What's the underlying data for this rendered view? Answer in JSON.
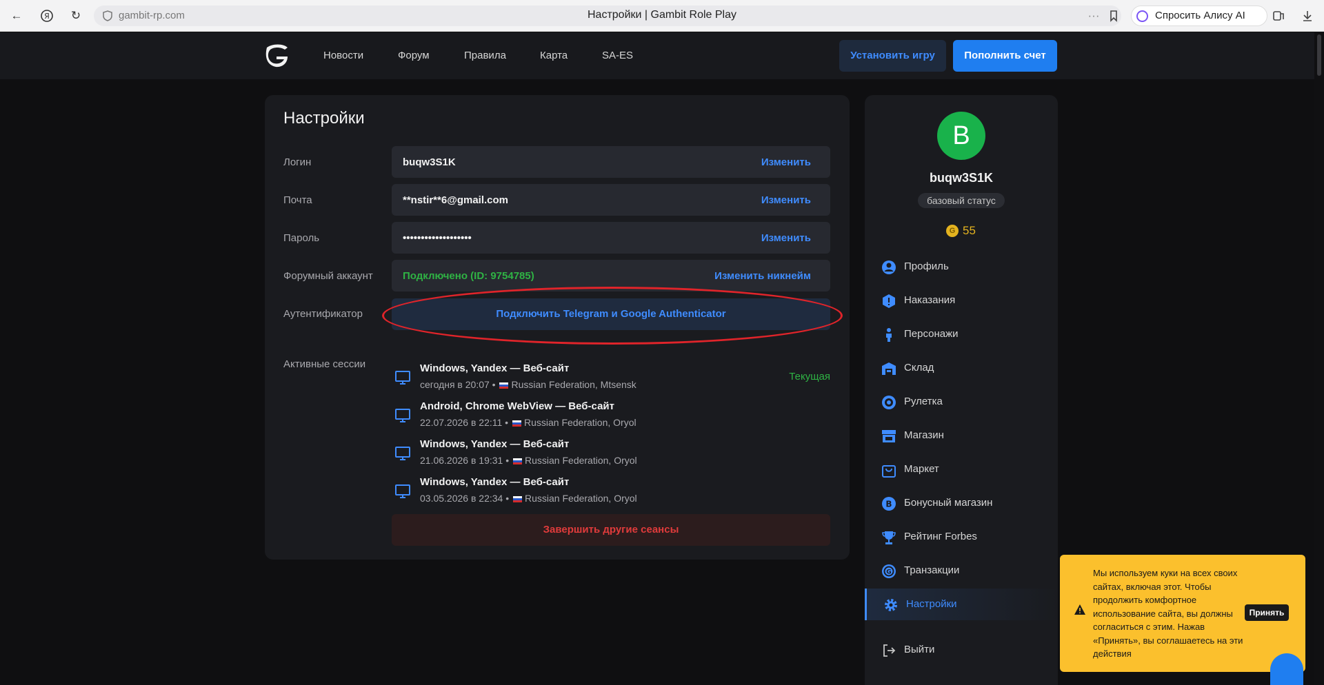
{
  "browser": {
    "url": "gambit-rp.com",
    "tab_title": "Настройки | Gambit Role Play",
    "alice_label": "Спросить Алису AI"
  },
  "nav": {
    "items": [
      "Новости",
      "Форум",
      "Правила",
      "Карта",
      "SA-ES"
    ],
    "install_label": "Установить игру",
    "topup_label": "Пополнить счет"
  },
  "settings": {
    "title": "Настройки",
    "rows": [
      {
        "label": "Логин",
        "value": "buqw3S1K",
        "action": "Изменить"
      },
      {
        "label": "Почта",
        "value": "**nstir**6@gmail.com",
        "action": "Изменить"
      },
      {
        "label": "Пароль",
        "value": "•••••••••••••••••••",
        "action": "Изменить"
      },
      {
        "label": "Форумный аккаунт",
        "value": "Подключено (ID: 9754785)",
        "action": "Изменить никнейм"
      }
    ],
    "auth_label": "Аутентификатор",
    "auth_button": "Подключить Telegram и Google Authenticator",
    "sessions_label": "Активные сессии",
    "sessions": [
      {
        "name": "Windows, Yandex — Веб-сайт",
        "time": "сегодня в 20:07 •",
        "location": "Russian Federation, Mtsensk",
        "current": "Текущая"
      },
      {
        "name": "Android, Chrome WebView — Веб-сайт",
        "time": "22.07.2026 в 22:11 •",
        "location": "Russian Federation, Oryol"
      },
      {
        "name": "Windows, Yandex — Веб-сайт",
        "time": "21.06.2026 в 19:31 •",
        "location": "Russian Federation, Oryol"
      },
      {
        "name": "Windows, Yandex — Веб-сайт",
        "time": "03.05.2026 в 22:34 •",
        "location": "Russian Federation, Oryol"
      }
    ],
    "end_sessions_button": "Завершить другие сеансы"
  },
  "profile": {
    "avatar_letter": "B",
    "username": "buqw3S1K",
    "status": "базовый статус",
    "coins": "55",
    "coin_glyph": "G"
  },
  "menu": {
    "items": [
      {
        "label": "Профиль",
        "icon": "user-icon"
      },
      {
        "label": "Наказания",
        "icon": "warning-icon"
      },
      {
        "label": "Персонажи",
        "icon": "person-icon"
      },
      {
        "label": "Склад",
        "icon": "warehouse-icon"
      },
      {
        "label": "Рулетка",
        "icon": "roulette-icon"
      },
      {
        "label": "Магазин",
        "icon": "store-icon"
      },
      {
        "label": "Маркет",
        "icon": "bag-icon"
      },
      {
        "label": "Бонусный магазин",
        "icon": "bonus-icon"
      },
      {
        "label": "Рейтинг Forbes",
        "icon": "trophy-icon"
      },
      {
        "label": "Транзакции",
        "icon": "coin-icon"
      },
      {
        "label": "Настройки",
        "icon": "gear-icon",
        "active": true
      }
    ],
    "logout": "Выйти"
  },
  "cookie": {
    "text": "Мы используем куки на всех своих сайтах, включая этот. Чтобы продолжить комфортное использование сайта, вы должны согласиться с этим. Нажав «Принять», вы соглашаетесь на эти действия",
    "accept": "Принять"
  },
  "colors": {
    "accent": "#1f7ef0",
    "link": "#3f8cff",
    "success": "#2fb344",
    "danger": "#e03b3b",
    "highlight_ellipse": "#e0242a",
    "cookie_bg": "#fbc02d"
  }
}
